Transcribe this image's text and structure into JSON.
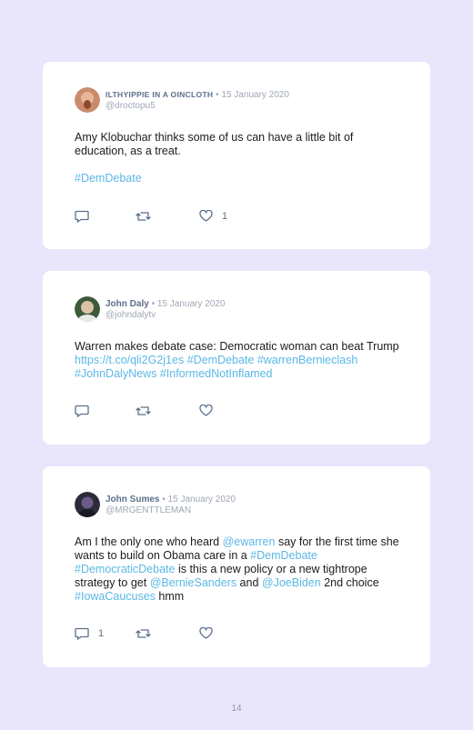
{
  "tweets": [
    {
      "author": "ILTHYIPPIE IN A OINCLOTH",
      "separator": "•",
      "date": "15 January 2020",
      "handle": "@droctopu5",
      "body": [
        {
          "text": "Amy Klobuchar thinks some of us can have a little bit of education, as a treat.",
          "link": false
        },
        {
          "break": true
        },
        {
          "text": "#DemDebate",
          "link": true
        }
      ],
      "reply_count": "",
      "retweet_count": "",
      "like_count": "1",
      "avatar_colors": [
        "#c98c6b",
        "#8a4a2e"
      ]
    },
    {
      "author": "John Daly",
      "separator": "•",
      "date": "15 January 2020",
      "handle": "@johndalytv",
      "body": [
        {
          "text": "Warren makes debate case: Democratic woman can beat Trump ",
          "link": false
        },
        {
          "text": "https://t.co/qli2G2j1es",
          "link": true
        },
        {
          "text": " ",
          "link": false
        },
        {
          "text": "#DemDebate",
          "link": true
        },
        {
          "text": " ",
          "link": false
        },
        {
          "text": "#warrenBernieclash",
          "link": true
        },
        {
          "text": " ",
          "link": false
        },
        {
          "text": "#JohnDalyNews",
          "link": true
        },
        {
          "text": " ",
          "link": false
        },
        {
          "text": "#InformedNotInflamed",
          "link": true
        }
      ],
      "reply_count": "",
      "retweet_count": "",
      "like_count": "",
      "avatar_colors": [
        "#d9c2a7",
        "#3d5a3a"
      ]
    },
    {
      "author": "John Sumes",
      "separator": "•",
      "date": "15 January 2020",
      "handle": "@MRGENTTLEMAN",
      "body": [
        {
          "text": "Am I the only one who heard ",
          "link": false
        },
        {
          "text": "@ewarren",
          "link": true
        },
        {
          "text": " say for the first time she wants to build on Obama care in a ",
          "link": false
        },
        {
          "text": "#DemDebate",
          "link": true
        },
        {
          "text": " ",
          "link": false
        },
        {
          "text": "#DemocraticDebate",
          "link": true
        },
        {
          "text": " is this a new policy or a new tightrope strategy to get ",
          "link": false
        },
        {
          "text": "@BernieSanders",
          "link": true
        },
        {
          "text": " and ",
          "link": false
        },
        {
          "text": "@JoeBiden",
          "link": true
        },
        {
          "text": " 2nd choice ",
          "link": false
        },
        {
          "text": "#IowaCaucuses",
          "link": true
        },
        {
          "text": " hmm",
          "link": false
        }
      ],
      "reply_count": "1",
      "retweet_count": "",
      "like_count": "",
      "avatar_colors": [
        "#2b2b3a",
        "#6b5a8a"
      ]
    }
  ],
  "icons": {
    "reply": "speech-bubble-icon",
    "retweet": "retweet-arrows-icon",
    "like": "heart-outline-icon"
  },
  "colors": {
    "background": "#e9e6fc",
    "card": "#ffffff",
    "link": "#5ab8e6",
    "author": "#5b6f8a",
    "meta": "#a0a8b4",
    "icon": "#5b6f8a"
  },
  "page_number": "14"
}
